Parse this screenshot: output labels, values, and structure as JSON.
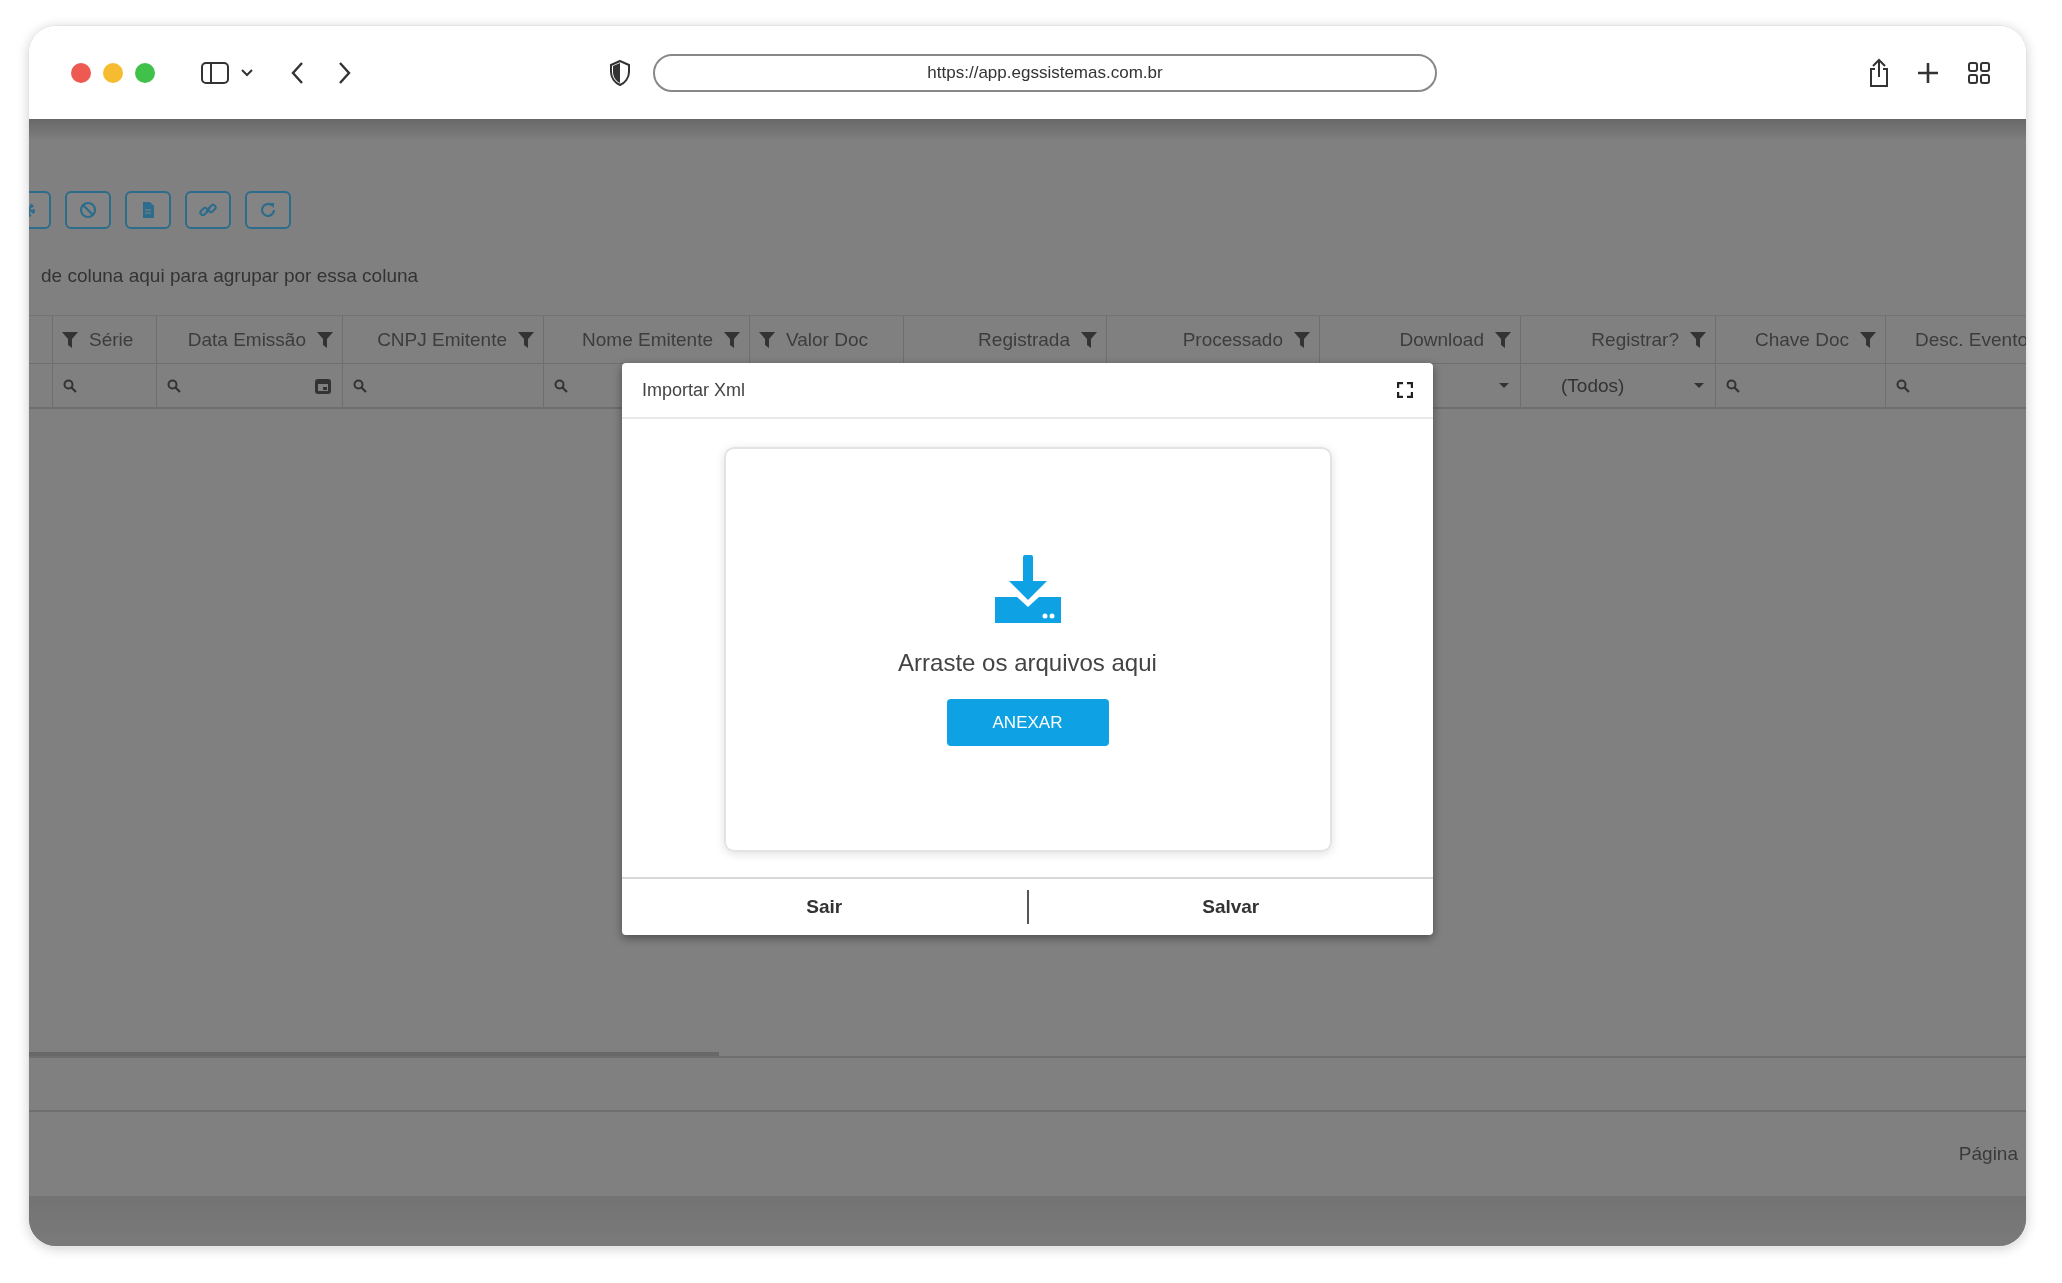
{
  "browser": {
    "url": "https://app.egssistemas.com.br"
  },
  "group_hint": "de coluna aqui para agrupar por essa coluna",
  "columns": [
    {
      "label": "Série",
      "filter_icon": true,
      "icon_first": true,
      "filter": {
        "kind": "search"
      }
    },
    {
      "label": "Data Emissão",
      "filter_icon": true,
      "icon_first": false,
      "filter": {
        "kind": "date"
      }
    },
    {
      "label": "CNPJ Emitente",
      "filter_icon": true,
      "icon_first": false,
      "filter": {
        "kind": "search"
      }
    },
    {
      "label": "Nome Emitente",
      "filter_icon": true,
      "icon_first": false,
      "filter": {
        "kind": "search"
      }
    },
    {
      "label": "Valor Doc",
      "filter_icon": true,
      "icon_first": true
    },
    {
      "label": "Registrada",
      "filter_icon": true,
      "icon_first": false
    },
    {
      "label": "Processado",
      "filter_icon": true,
      "icon_first": false
    },
    {
      "label": "Download",
      "filter_icon": true,
      "icon_first": false,
      "filter": {
        "kind": "select"
      }
    },
    {
      "label": "Registrar?",
      "filter_icon": true,
      "icon_first": false,
      "filter": {
        "kind": "select",
        "value": "(Todos)"
      }
    },
    {
      "label": "Chave Doc",
      "filter_icon": true,
      "icon_first": false,
      "filter": {
        "kind": "search"
      }
    },
    {
      "label": "Desc. Evento",
      "filter_icon": false,
      "filter": {
        "kind": "search"
      }
    }
  ],
  "pager": "Página",
  "dialog": {
    "title": "Importar Xml",
    "drop_text": "Arraste os arquivos aqui",
    "attach_button": "ANEXAR",
    "buttons": [
      "Sair",
      "Salvar"
    ]
  }
}
